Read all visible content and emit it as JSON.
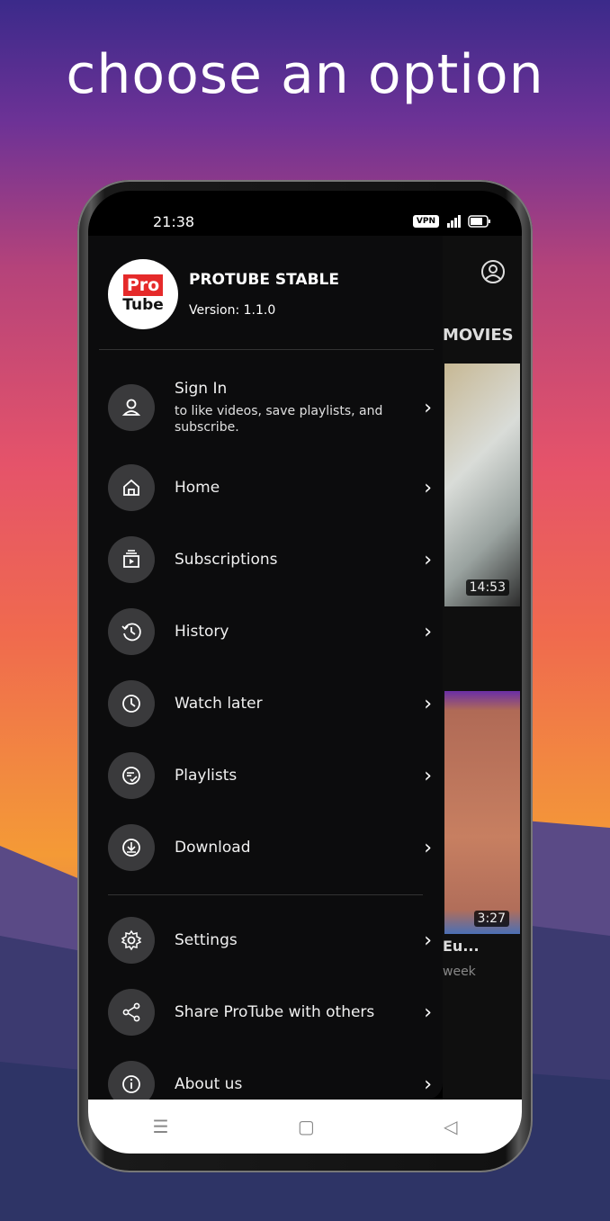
{
  "headline": "choose an option",
  "status_bar": {
    "time": "21:38",
    "vpn": "VPN"
  },
  "app": {
    "name": "PROTUBE STABLE",
    "version": "Version: 1.1.0",
    "logo_top": "Pro",
    "logo_bottom": "Tube"
  },
  "background_app": {
    "tab_label": "MOVIES",
    "durations": [
      "14:53",
      "3:27"
    ],
    "title_fragment": "Eu...",
    "meta_fragment": "week"
  },
  "menu": [
    {
      "label": "Sign In",
      "sub": "to like videos, save playlists, and subscribe.",
      "icon": "person-icon"
    },
    {
      "label": "Home",
      "icon": "home-icon"
    },
    {
      "label": "Subscriptions",
      "icon": "subscriptions-icon"
    },
    {
      "label": "History",
      "icon": "history-icon"
    },
    {
      "label": "Watch later",
      "icon": "clock-icon"
    },
    {
      "label": "Playlists",
      "icon": "playlist-icon"
    },
    {
      "label": "Download",
      "icon": "download-icon"
    },
    {
      "label": "Settings",
      "icon": "gear-icon"
    },
    {
      "label": "Share ProTube with others",
      "icon": "share-icon"
    },
    {
      "label": "About us",
      "icon": "info-icon"
    }
  ],
  "colors": {
    "drawer_bg": "#0c0c0d",
    "icon_circle": "#3a3a3c",
    "logo_red": "#e52a2a"
  }
}
